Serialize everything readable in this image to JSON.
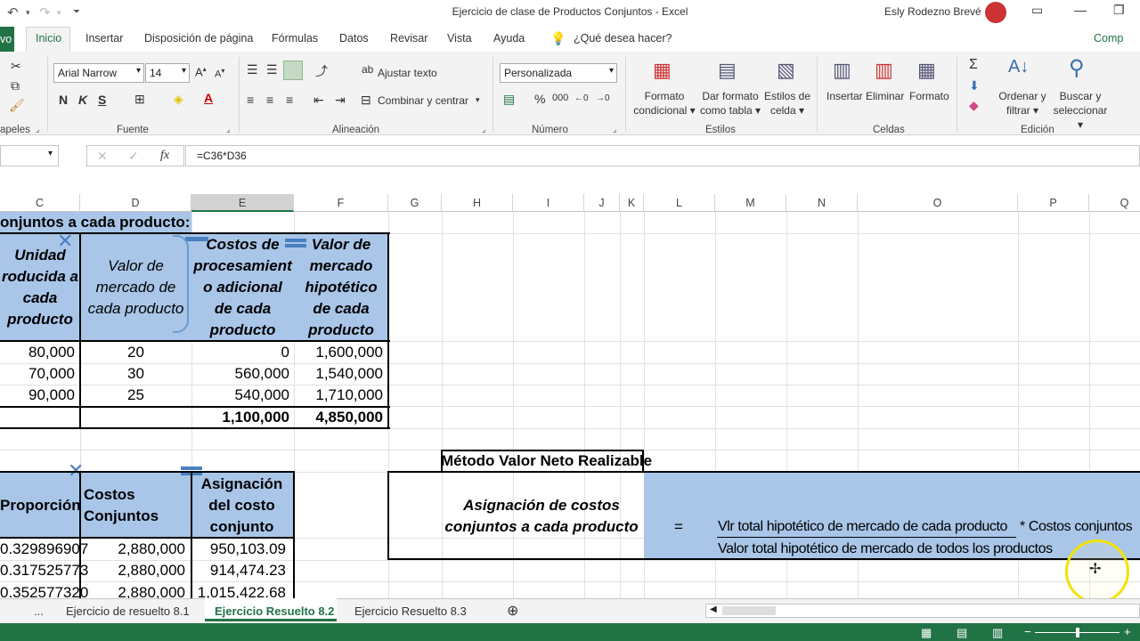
{
  "window": {
    "title": "Ejercicio de clase de Productos Conjuntos  -  Excel",
    "user": "Esly Rodezno Brevé"
  },
  "tabs": {
    "file": "vo",
    "items": [
      "Inicio",
      "Insertar",
      "Disposición de página",
      "Fórmulas",
      "Datos",
      "Revisar",
      "Vista",
      "Ayuda"
    ],
    "tell_me": "¿Qué desea hacer?",
    "share": "Comp"
  },
  "ribbon": {
    "clipboard_label": "apeles",
    "font_name": "Arial Narrow",
    "font_size": "14",
    "font_label": "Fuente",
    "wrap_text": "Ajustar texto",
    "merge_center": "Combinar y centrar",
    "alignment_label": "Alineación",
    "number_format": "Personalizada",
    "number_label": "Número",
    "cond_format": [
      "Formato",
      "condicional"
    ],
    "format_table": [
      "Dar formato",
      "como tabla"
    ],
    "cell_styles": [
      "Estilos de",
      "celda"
    ],
    "styles_label": "Estilos",
    "insert": "Insertar",
    "delete": "Eliminar",
    "format": "Formato",
    "cells_label": "Celdas",
    "sort_filter": [
      "Ordenar y",
      "filtrar"
    ],
    "find_select": [
      "Buscar y",
      "seleccionar"
    ],
    "editing_label": "Edición"
  },
  "formula_bar": {
    "formula": "=C36*D36"
  },
  "columns": [
    "C",
    "D",
    "E",
    "F",
    "G",
    "H",
    "I",
    "J",
    "K",
    "L",
    "M",
    "N",
    "O",
    "P",
    "Q"
  ],
  "table1": {
    "title": "onjuntos a cada producto:",
    "headers": {
      "c": [
        "Unidad",
        "roducida a",
        "cada",
        "producto"
      ],
      "d": [
        "Valor de",
        "mercado de",
        "cada producto"
      ],
      "e": [
        "Costos de",
        "procesamient",
        "o adicional",
        "de cada",
        "producto"
      ],
      "f": [
        "Valor de",
        "mercado",
        "hipotético",
        "de cada",
        "producto"
      ]
    },
    "rows": [
      {
        "c": "80,000",
        "d": "20",
        "e": "0",
        "f": "1,600,000"
      },
      {
        "c": "70,000",
        "d": "30",
        "e": "560,000",
        "f": "1,540,000"
      },
      {
        "c": "90,000",
        "d": "25",
        "e": "540,000",
        "f": "1,710,000"
      }
    ],
    "totals": {
      "e": "1,100,000",
      "f": "4,850,000"
    }
  },
  "table2": {
    "headers": {
      "c": "Proporción",
      "d": [
        "Costos",
        "Conjuntos"
      ],
      "e": [
        "Asignación",
        "del costo",
        "conjunto"
      ]
    },
    "rows": [
      {
        "c": "0.329896907",
        "d": "2,880,000",
        "e": "950,103.09"
      },
      {
        "c": "0.317525773",
        "d": "2,880,000",
        "e": "914,474.23"
      },
      {
        "c": "0.352577320",
        "d": "2,880,000",
        "e": "1,015,422.68"
      }
    ]
  },
  "method": {
    "title": "Método Valor Neto Realizable",
    "label": [
      "Asignación de costos",
      "conjuntos a cada producto"
    ],
    "equals": "=",
    "numerator": "Vlr total hipotético de mercado de cada producto",
    "times": "* Costos conjuntos",
    "denominator": "Valor total hipotético de mercado de todos los productos"
  },
  "sheet_tabs": {
    "more": "...",
    "items": [
      "Ejercicio de resuelto 8.1",
      "Ejercicio Resuelto 8.2",
      "Ejercicio Resuelto 8.3"
    ]
  },
  "colors": {
    "excel_green": "#217346",
    "cell_blue": "#a9c6e8"
  }
}
